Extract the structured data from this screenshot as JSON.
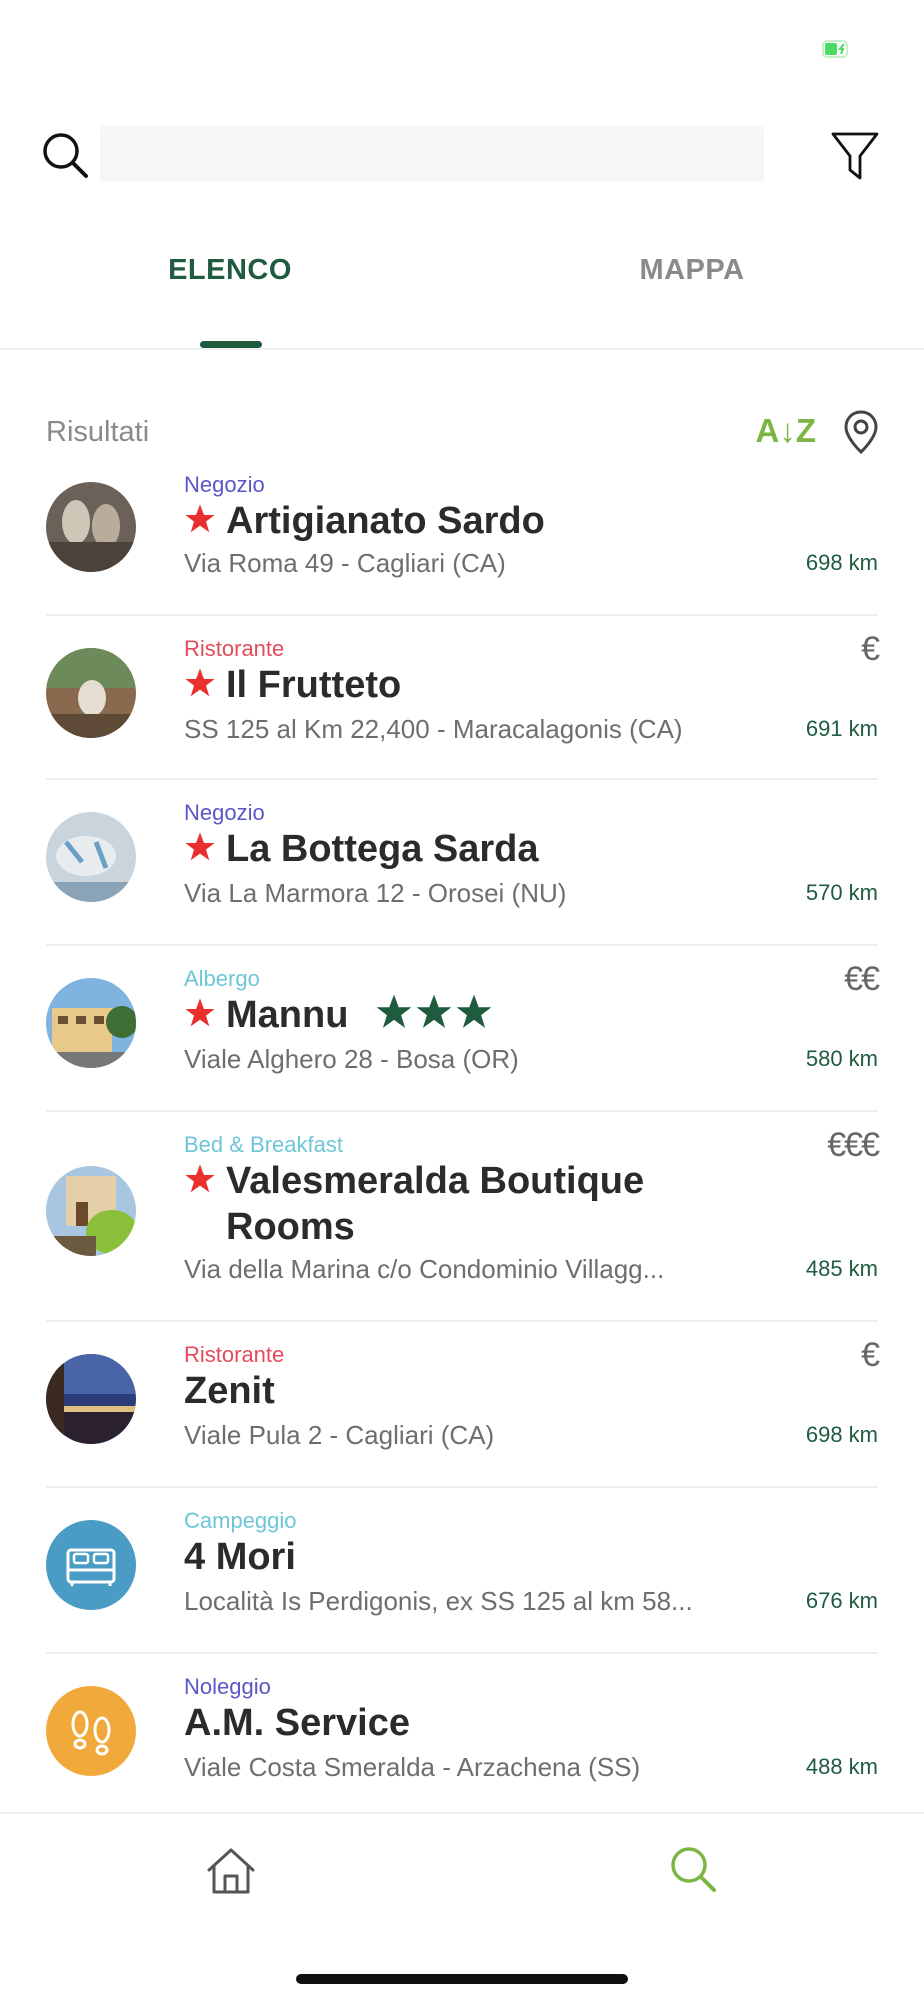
{
  "colors": {
    "accent": "#1f5b3f",
    "accent_light": "#7bb544",
    "category_negozio": "#5b57c8",
    "category_ristorante": "#e34c5a",
    "category_albergo": "#6cc6d8"
  },
  "search": {
    "placeholder": "",
    "value": ""
  },
  "tabs": [
    {
      "label": "ELENCO",
      "active": true
    },
    {
      "label": "MAPPA",
      "active": false
    }
  ],
  "results": {
    "label": "Risultati",
    "sort_label": "A↓Z"
  },
  "items": [
    {
      "category": "Negozio",
      "title": "Artigianato Sardo",
      "featured": true,
      "address": "Via Roma 49 - Cagliari (CA)",
      "distance": "698 km",
      "price": "",
      "rating_stars": 0,
      "image": "photo"
    },
    {
      "category": "Ristorante",
      "title": "Il Frutteto",
      "featured": true,
      "address": "SS 125 al Km 22,400 - Maracalagonis (CA)",
      "distance": "691 km",
      "price": "€",
      "rating_stars": 0,
      "image": "photo"
    },
    {
      "category": "Negozio",
      "title": "La Bottega Sarda",
      "featured": true,
      "address": "Via La Marmora 12 - Orosei (NU)",
      "distance": "570 km",
      "price": "",
      "rating_stars": 0,
      "image": "photo"
    },
    {
      "category": "Albergo",
      "title": "Mannu",
      "featured": true,
      "address": "Viale Alghero 28 - Bosa (OR)",
      "distance": "580 km",
      "price": "€€",
      "rating_stars": 3,
      "image": "photo"
    },
    {
      "category": "Bed & Breakfast",
      "title_line1": "Valesmeralda Boutique",
      "title_line2": "Rooms",
      "featured": true,
      "address": "Via della Marina c/o Condominio Villagg...",
      "distance": "485 km",
      "price": "€€€",
      "rating_stars": 0,
      "image": "photo"
    },
    {
      "category": "Ristorante",
      "title": "Zenit",
      "featured": false,
      "address": "Viale Pula 2 - Cagliari (CA)",
      "distance": "698 km",
      "price": "€",
      "rating_stars": 0,
      "image": "photo"
    },
    {
      "category": "Campeggio",
      "title": "4 Mori",
      "featured": false,
      "address": "Località Is Perdigonis, ex SS 125 al km 58...",
      "distance": "676 km",
      "price": "",
      "rating_stars": 0,
      "image": "bed-icon"
    },
    {
      "category": "Noleggio",
      "title": "A.M. Service",
      "featured": false,
      "address": "Viale Costa Smeralda - Arzachena (SS)",
      "distance": "488 km",
      "price": "",
      "rating_stars": 0,
      "image": "footprints-icon"
    }
  ],
  "bottom_nav": {
    "items": [
      {
        "icon": "home-icon",
        "active": false
      },
      {
        "icon": "search-icon",
        "active": true
      }
    ]
  }
}
